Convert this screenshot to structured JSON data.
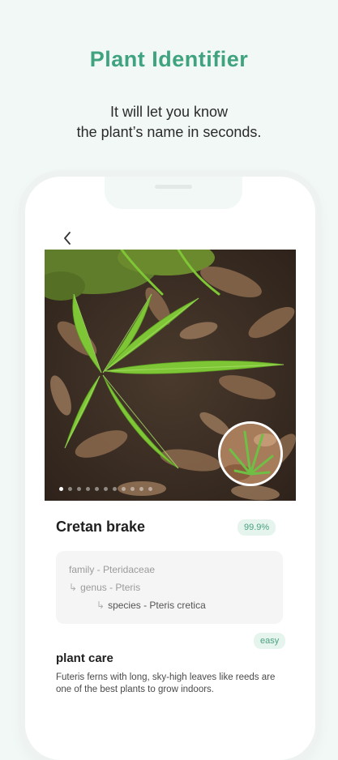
{
  "hero": {
    "title": "Plant Identifier",
    "subtitle_line1": "It will let you know",
    "subtitle_line2": "the plant’s name in seconds."
  },
  "result": {
    "name": "Cretan brake",
    "confidence": "99.9%",
    "taxonomy": {
      "family": "family - Pteridaceae",
      "genus": "genus - Pteris",
      "species": "species - Pteris cretica"
    },
    "difficulty": "easy",
    "care_title": "plant care",
    "care_description": "Futeris ferns with long, sky-high leaves like reeds are one of the best plants to grow indoors."
  },
  "gallery": {
    "active_index": 0,
    "dot_count": 11
  },
  "colors": {
    "accent": "#3fa37f",
    "background": "#f1f8f5",
    "badge_bg": "#e6f4ee"
  }
}
